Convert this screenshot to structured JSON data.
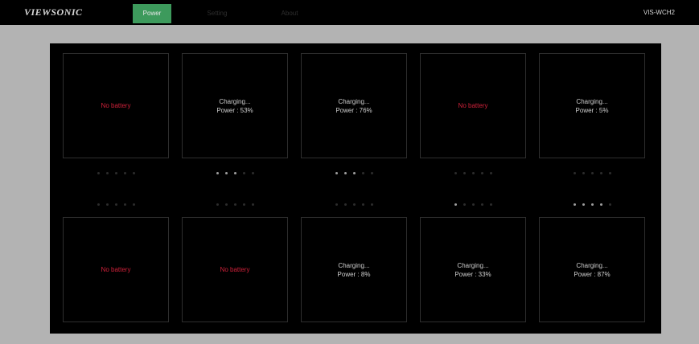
{
  "header": {
    "logo": "VIEWSONIC",
    "tabs": [
      {
        "label": "Power",
        "active": true
      },
      {
        "label": "Setting",
        "active": false
      },
      {
        "label": "About",
        "active": false
      }
    ],
    "model": "VIS-WCH2"
  },
  "colors": {
    "active_tab": "#3d9a5c",
    "no_battery": "#d0213a",
    "panel": "#000000",
    "background": "#b3b3b3"
  },
  "slots": [
    {
      "status": "No battery",
      "power": "",
      "level": 0
    },
    {
      "status": "Charging...",
      "power": "Power : 53%",
      "level": 3
    },
    {
      "status": "Charging...",
      "power": "Power : 76%",
      "level": 3
    },
    {
      "status": "No battery",
      "power": "",
      "level": 0
    },
    {
      "status": "Charging...",
      "power": "Power : 5%",
      "level": 0
    },
    {
      "status": "No battery",
      "power": "",
      "level": 0
    },
    {
      "status": "No battery",
      "power": "",
      "level": 0
    },
    {
      "status": "Charging...",
      "power": "Power : 8%",
      "level": 0
    },
    {
      "status": "Charging...",
      "power": "Power : 33%",
      "level": 1
    },
    {
      "status": "Charging...",
      "power": "Power : 87%",
      "level": 4
    }
  ]
}
